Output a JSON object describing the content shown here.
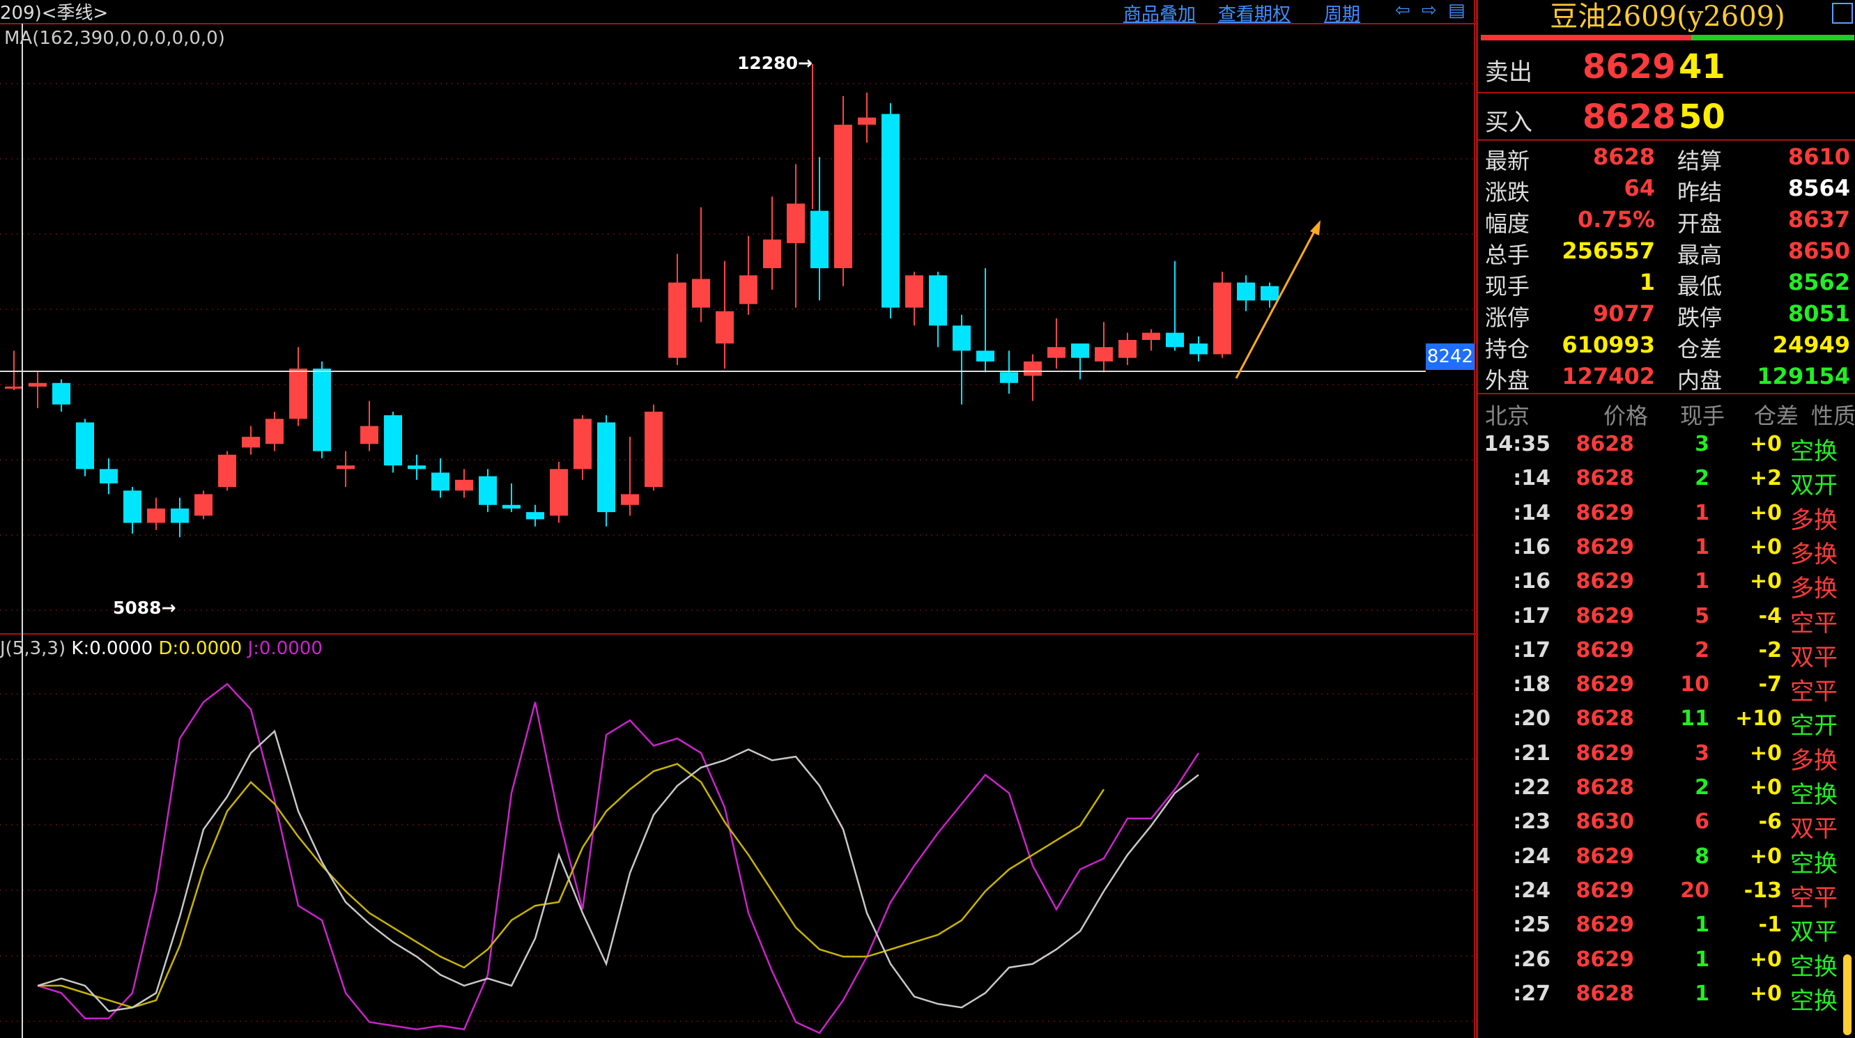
{
  "header": {
    "title": "209)<季线>",
    "links": [
      "商品叠加",
      "查看期权",
      "周期"
    ],
    "ma_label": "MA(162,390,0,0,0,0,0,0)",
    "kdj": {
      "name": "J(5,3,3)",
      "k": "K:0.0000",
      "d": "D:0.0000",
      "j": "J:0.0000"
    },
    "current_price_tag": "8242",
    "high_label": "12280→",
    "low_label": "5088→"
  },
  "colors": {
    "up": "#ff4444",
    "down": "#00e5ff",
    "k": "#c8c8c8",
    "d": "#c8b400",
    "j": "#cc22cc",
    "grid": "#7a1010"
  },
  "chart_data": {
    "type": "candlestick",
    "price_ylim": [
      4800,
      13200
    ],
    "candles": [
      [
        0,
        8200,
        8200,
        8700,
        8150
      ],
      [
        1,
        8200,
        8250,
        8400,
        7900
      ],
      [
        2,
        8250,
        7950,
        8300,
        7850
      ],
      [
        3,
        7700,
        7050,
        7750,
        6950
      ],
      [
        4,
        7050,
        6850,
        7200,
        6700
      ],
      [
        5,
        6750,
        6300,
        6800,
        6150
      ],
      [
        6,
        6300,
        6500,
        6650,
        6200
      ],
      [
        7,
        6500,
        6300,
        6650,
        6100
      ],
      [
        8,
        6400,
        6700,
        6750,
        6350
      ],
      [
        9,
        6800,
        7250,
        7300,
        6750
      ],
      [
        10,
        7350,
        7500,
        7650,
        7250
      ],
      [
        11,
        7400,
        7750,
        7850,
        7300
      ],
      [
        12,
        7750,
        8450,
        8750,
        7650
      ],
      [
        13,
        8450,
        7300,
        8550,
        7200
      ],
      [
        14,
        7050,
        7100,
        7300,
        6800
      ],
      [
        15,
        7400,
        7650,
        8000,
        7300
      ],
      [
        16,
        7800,
        7100,
        7850,
        7000
      ],
      [
        17,
        7100,
        7050,
        7250,
        6900
      ],
      [
        18,
        7000,
        6750,
        7200,
        6650
      ],
      [
        19,
        6750,
        6900,
        7050,
        6650
      ],
      [
        20,
        6950,
        6550,
        7050,
        6450
      ],
      [
        21,
        6550,
        6500,
        6850,
        6450
      ],
      [
        22,
        6450,
        6350,
        6550,
        6250
      ],
      [
        23,
        6400,
        7050,
        7150,
        6300
      ],
      [
        24,
        7050,
        7750,
        7800,
        6900
      ],
      [
        25,
        7700,
        6450,
        7800,
        6250
      ],
      [
        26,
        6550,
        6700,
        7500,
        6400
      ],
      [
        27,
        6800,
        7850,
        7950,
        6750
      ],
      [
        28,
        8600,
        9650,
        10050,
        8500
      ],
      [
        29,
        9300,
        9700,
        10700,
        9100
      ],
      [
        30,
        8800,
        9250,
        9950,
        8450
      ],
      [
        31,
        9350,
        9750,
        10300,
        9200
      ],
      [
        32,
        9850,
        10250,
        10850,
        9550
      ],
      [
        33,
        10200,
        10750,
        11300,
        9300
      ],
      [
        34,
        10650,
        9850,
        11400,
        9400
      ],
      [
        35,
        9850,
        11850,
        12250,
        9600
      ],
      [
        36,
        11850,
        11950,
        12300,
        11600
      ],
      [
        37,
        12000,
        9300,
        12150,
        9150
      ],
      [
        38,
        9300,
        9750,
        9800,
        9050
      ],
      [
        39,
        9750,
        9050,
        9800,
        8750
      ],
      [
        40,
        9050,
        8700,
        9200,
        7950
      ],
      [
        41,
        8700,
        8550,
        9850,
        8400
      ],
      [
        42,
        8400,
        8250,
        8700,
        8100
      ],
      [
        43,
        8350,
        8550,
        8650,
        8000
      ],
      [
        44,
        8600,
        8750,
        9150,
        8450
      ],
      [
        45,
        8800,
        8600,
        8800,
        8300
      ],
      [
        46,
        8550,
        8750,
        9100,
        8400
      ],
      [
        47,
        8600,
        8850,
        8950,
        8500
      ],
      [
        48,
        8850,
        8950,
        9000,
        8700
      ],
      [
        49,
        8950,
        8750,
        9950,
        8700
      ],
      [
        50,
        8800,
        8650,
        8900,
        8550
      ],
      [
        51,
        8650,
        9650,
        9800,
        8600
      ],
      [
        52,
        9650,
        9400,
        9750,
        9250
      ],
      [
        53,
        9600,
        9400,
        9650,
        9300
      ]
    ],
    "kdj_ylim": [
      0,
      105
    ],
    "k": [
      14,
      16,
      14,
      7,
      8,
      12,
      33,
      57,
      66,
      78,
      84,
      62,
      48,
      37,
      31,
      26,
      22,
      17,
      14,
      16,
      14,
      27,
      50,
      34,
      20,
      45,
      61,
      69,
      74,
      76,
      79,
      76,
      77,
      69,
      57,
      34,
      20,
      11,
      9,
      8,
      12,
      19,
      20,
      24,
      29,
      40,
      50,
      58,
      67,
      72
    ],
    "d": [
      14,
      14,
      12,
      10,
      8,
      10,
      25,
      46,
      62,
      70,
      64,
      55,
      47,
      40,
      34,
      30,
      26,
      22,
      19,
      24,
      32,
      36,
      37,
      52,
      62,
      68,
      73,
      75,
      70,
      59,
      50,
      40,
      30,
      24,
      22,
      22,
      24,
      26,
      28,
      32,
      40,
      46,
      50,
      54,
      58,
      68
    ],
    "j": [
      14,
      12,
      5,
      5,
      12,
      40,
      82,
      92,
      97,
      90,
      65,
      36,
      32,
      12,
      4,
      3,
      2,
      3,
      2,
      17,
      67,
      92,
      60,
      35,
      83,
      87,
      80,
      82,
      78,
      63,
      34,
      18,
      4,
      1,
      10,
      22,
      37,
      47,
      56,
      64,
      72,
      67,
      47,
      35,
      46,
      49,
      60,
      60,
      68,
      78
    ]
  },
  "panel": {
    "title": "豆油2609(y2609)",
    "ask": {
      "label": "卖出",
      "price": "8629",
      "vol": "41"
    },
    "bid": {
      "label": "买入",
      "price": "8628",
      "vol": "50"
    },
    "stats": [
      {
        "l1": "最新",
        "v1": "8628",
        "c1": "red",
        "l2": "结算",
        "v2": "8610",
        "c2": "red"
      },
      {
        "l1": "涨跌",
        "v1": "64",
        "c1": "red",
        "l2": "昨结",
        "v2": "8564",
        "c2": "white"
      },
      {
        "l1": "幅度",
        "v1": "0.75%",
        "c1": "red",
        "l2": "开盘",
        "v2": "8637",
        "c2": "red"
      },
      {
        "l1": "总手",
        "v1": "256557",
        "c1": "yellow",
        "l2": "最高",
        "v2": "8650",
        "c2": "red"
      },
      {
        "l1": "现手",
        "v1": "1",
        "c1": "yellow",
        "l2": "最低",
        "v2": "8562",
        "c2": "green"
      },
      {
        "l1": "涨停",
        "v1": "9077",
        "c1": "red",
        "l2": "跌停",
        "v2": "8051",
        "c2": "green"
      },
      {
        "l1": "持仓",
        "v1": "610993",
        "c1": "yellow",
        "l2": "仓差",
        "v2": "24949",
        "c2": "yellow"
      },
      {
        "l1": "外盘",
        "v1": "127402",
        "c1": "red",
        "l2": "内盘",
        "v2": "129154",
        "c2": "green"
      }
    ],
    "tick_header": [
      "北京",
      "价格",
      "现手",
      "仓差",
      "性质"
    ],
    "ticks": [
      {
        "t": "14:35",
        "p": "8628",
        "pc": "red",
        "v": "3",
        "vc": "green",
        "oi": "+0",
        "oic": "yellow",
        "n": "空换",
        "nc": "green"
      },
      {
        "t": ":14",
        "p": "8628",
        "pc": "red",
        "v": "2",
        "vc": "green",
        "oi": "+2",
        "oic": "yellow",
        "n": "双开",
        "nc": "green"
      },
      {
        "t": ":14",
        "p": "8629",
        "pc": "red",
        "v": "1",
        "vc": "red",
        "oi": "+0",
        "oic": "yellow",
        "n": "多换",
        "nc": "red"
      },
      {
        "t": ":16",
        "p": "8629",
        "pc": "red",
        "v": "1",
        "vc": "red",
        "oi": "+0",
        "oic": "yellow",
        "n": "多换",
        "nc": "red"
      },
      {
        "t": ":16",
        "p": "8629",
        "pc": "red",
        "v": "1",
        "vc": "red",
        "oi": "+0",
        "oic": "yellow",
        "n": "多换",
        "nc": "red"
      },
      {
        "t": ":17",
        "p": "8629",
        "pc": "red",
        "v": "5",
        "vc": "red",
        "oi": "-4",
        "oic": "yellow",
        "n": "空平",
        "nc": "red"
      },
      {
        "t": ":17",
        "p": "8629",
        "pc": "red",
        "v": "2",
        "vc": "red",
        "oi": "-2",
        "oic": "yellow",
        "n": "双平",
        "nc": "red"
      },
      {
        "t": ":18",
        "p": "8629",
        "pc": "red",
        "v": "10",
        "vc": "red",
        "oi": "-7",
        "oic": "yellow",
        "n": "空平",
        "nc": "red"
      },
      {
        "t": ":20",
        "p": "8628",
        "pc": "red",
        "v": "11",
        "vc": "green",
        "oi": "+10",
        "oic": "yellow",
        "n": "空开",
        "nc": "green"
      },
      {
        "t": ":21",
        "p": "8629",
        "pc": "red",
        "v": "3",
        "vc": "red",
        "oi": "+0",
        "oic": "yellow",
        "n": "多换",
        "nc": "red"
      },
      {
        "t": ":22",
        "p": "8628",
        "pc": "red",
        "v": "2",
        "vc": "green",
        "oi": "+0",
        "oic": "yellow",
        "n": "空换",
        "nc": "green"
      },
      {
        "t": ":23",
        "p": "8630",
        "pc": "red",
        "v": "6",
        "vc": "red",
        "oi": "-6",
        "oic": "yellow",
        "n": "双平",
        "nc": "red"
      },
      {
        "t": ":24",
        "p": "8629",
        "pc": "red",
        "v": "8",
        "vc": "green",
        "oi": "+0",
        "oic": "yellow",
        "n": "空换",
        "nc": "green"
      },
      {
        "t": ":24",
        "p": "8629",
        "pc": "red",
        "v": "20",
        "vc": "red",
        "oi": "-13",
        "oic": "yellow",
        "n": "空平",
        "nc": "red"
      },
      {
        "t": ":25",
        "p": "8629",
        "pc": "red",
        "v": "1",
        "vc": "green",
        "oi": "-1",
        "oic": "yellow",
        "n": "双平",
        "nc": "green"
      },
      {
        "t": ":26",
        "p": "8629",
        "pc": "red",
        "v": "1",
        "vc": "green",
        "oi": "+0",
        "oic": "yellow",
        "n": "空换",
        "nc": "green"
      },
      {
        "t": ":27",
        "p": "8628",
        "pc": "red",
        "v": "1",
        "vc": "green",
        "oi": "+0",
        "oic": "yellow",
        "n": "空换",
        "nc": "green"
      }
    ]
  }
}
